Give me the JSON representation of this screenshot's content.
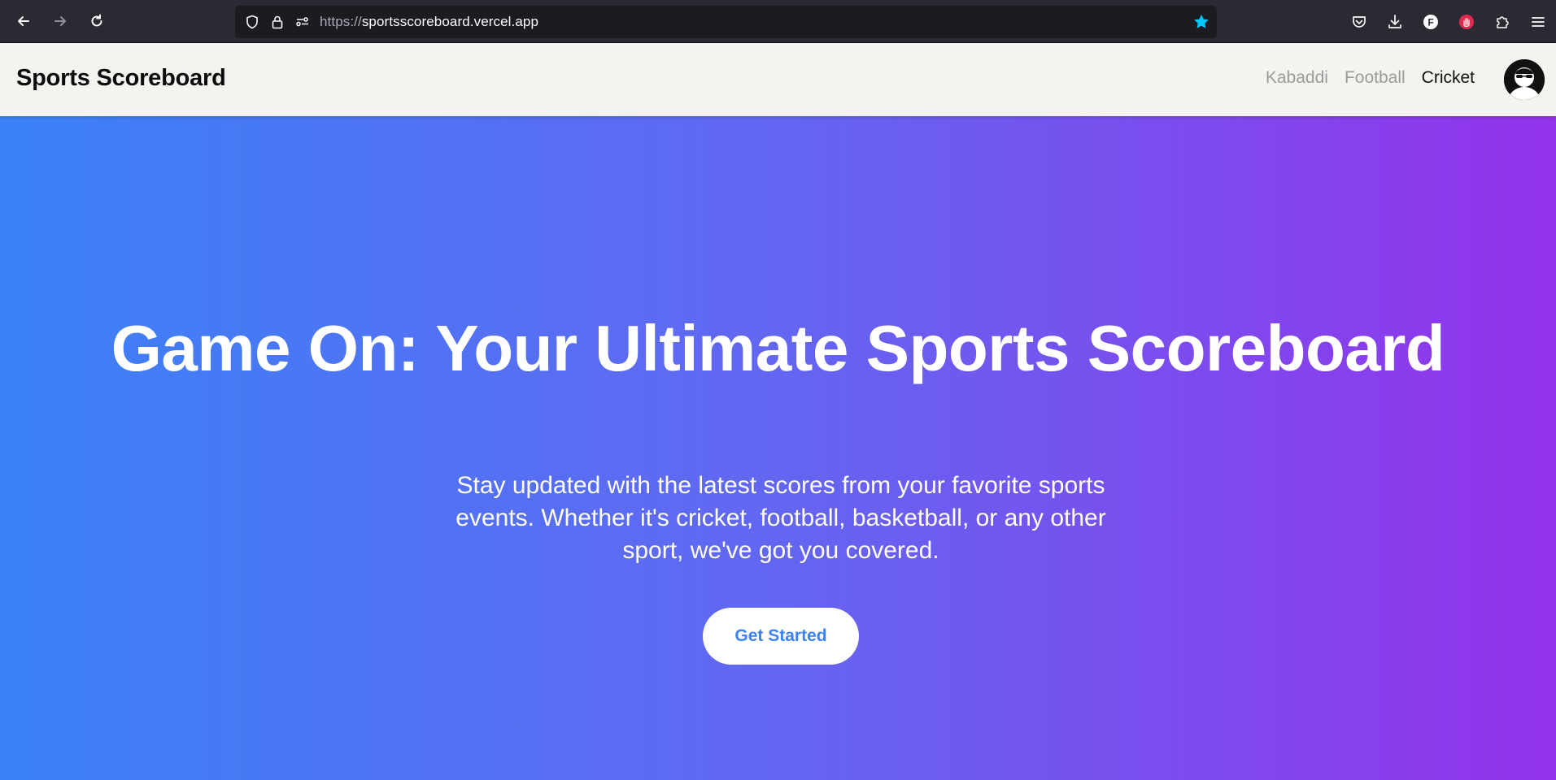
{
  "browser": {
    "url_scheme": "https://",
    "url_host": "sportsscoreboard.vercel.app",
    "icons": [
      "back-arrow-icon",
      "forward-arrow-icon",
      "reload-icon",
      "shield-icon",
      "lock-icon",
      "permissions-icon",
      "bookmark-star-icon",
      "pocket-icon",
      "download-icon",
      "account-icon",
      "extension-hand-icon",
      "extensions-puzzle-icon",
      "menu-icon"
    ],
    "account_letter": "F",
    "star_color": "#00c8ff"
  },
  "header": {
    "brand": "Sports Scoreboard",
    "nav": [
      {
        "label": "Kabaddi",
        "active": false
      },
      {
        "label": "Football",
        "active": false
      },
      {
        "label": "Cricket",
        "active": true
      }
    ]
  },
  "hero": {
    "title": "Game On: Your Ultimate Sports Scoreboard",
    "subtitle": "Stay updated with the latest scores from your favorite sports events. Whether it's cricket, football, basketball, or any other sport, we've got you covered.",
    "cta_label": "Get Started",
    "gradient": [
      "#3b82f6",
      "#6366f1",
      "#9333ea"
    ]
  }
}
